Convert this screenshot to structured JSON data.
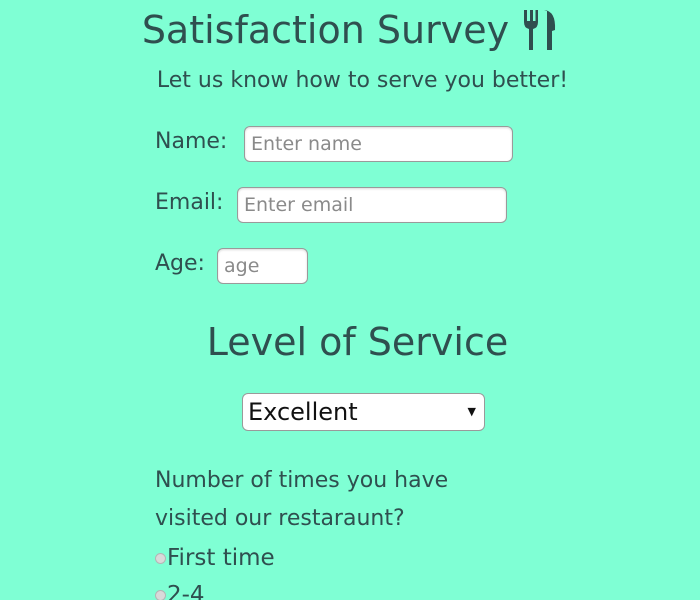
{
  "header": {
    "title": "Satisfaction Survey",
    "icon": "utensils-icon",
    "subtitle": "Let us know how to serve you better!"
  },
  "form": {
    "name": {
      "label": "Name:",
      "placeholder": "Enter name",
      "value": ""
    },
    "email": {
      "label": "Email:",
      "placeholder": "Enter email",
      "value": ""
    },
    "age": {
      "label": "Age:",
      "placeholder": "age",
      "value": ""
    }
  },
  "service": {
    "heading": "Level of Service",
    "selected": "Excellent"
  },
  "visits": {
    "question": "Number of times you have visited our restaraunt?",
    "options": [
      "First time",
      "2-4"
    ]
  },
  "colors": {
    "background": "#7fffd4",
    "text": "#2f4f4f"
  }
}
